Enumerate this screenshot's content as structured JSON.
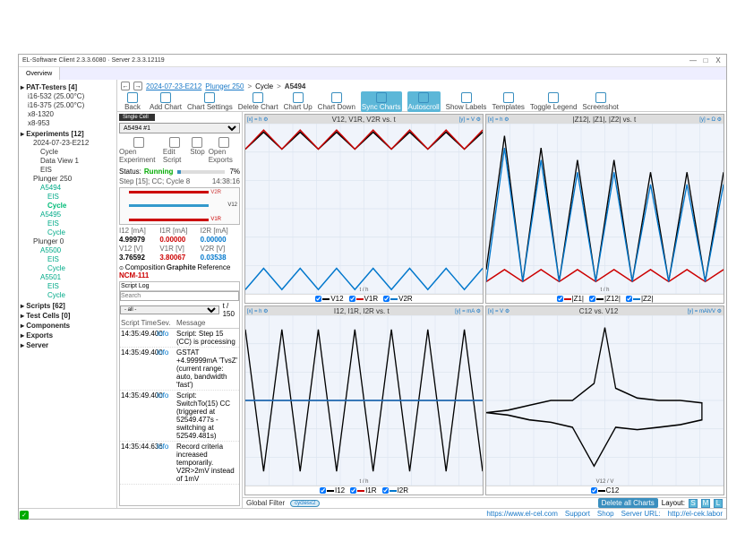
{
  "window": {
    "title": "EL-Software Client 2.3.3.6080 · Server 2.3.3.12119",
    "min": "—",
    "max": "□",
    "close": "X"
  },
  "tabs": {
    "overview": "Overview"
  },
  "sidebar": {
    "groups": [
      {
        "title": "PAT-Testers [4]",
        "items": [
          "i16-532 (25.00°C)",
          "i16-375 (25.00°C)",
          "x8-1320",
          "x8-953"
        ]
      },
      {
        "title": "Experiments [12]",
        "items": [
          {
            "t": "2024-07-23-E212",
            "cls": "ind1"
          },
          {
            "t": "Cycle",
            "cls": "ind2"
          },
          {
            "t": "Data View 1",
            "cls": "ind2"
          },
          {
            "t": "EIS",
            "cls": "ind2"
          },
          {
            "t": "Plunger 250",
            "cls": "ind1"
          },
          {
            "t": "A5494",
            "cls": "ind2 green"
          },
          {
            "t": "EIS",
            "cls": "ind3 green"
          },
          {
            "t": "Cycle",
            "cls": "ind3 sel"
          },
          {
            "t": "A5495",
            "cls": "ind2 green"
          },
          {
            "t": "EIS",
            "cls": "ind3 green"
          },
          {
            "t": "Cycle",
            "cls": "ind3 green"
          },
          {
            "t": "Plunger 0",
            "cls": "ind1"
          },
          {
            "t": "A5500",
            "cls": "ind2 green"
          },
          {
            "t": "EIS",
            "cls": "ind3 green"
          },
          {
            "t": "Cycle",
            "cls": "ind3 green"
          },
          {
            "t": "A5501",
            "cls": "ind2 green"
          },
          {
            "t": "EIS",
            "cls": "ind3 green"
          },
          {
            "t": "Cycle",
            "cls": "ind3 green"
          }
        ]
      },
      {
        "title": "Scripts [62]",
        "items": []
      },
      {
        "title": "Test Cells [0]",
        "items": []
      },
      {
        "title": "Components",
        "items": []
      },
      {
        "title": "Exports",
        "items": []
      },
      {
        "title": "Server",
        "items": []
      }
    ]
  },
  "breadcrumb": {
    "back": "←",
    "fwd": "→",
    "a": "2024-07-23-E212",
    "b": "Plunger 250",
    "c": "Cycle",
    "d": "A5494",
    "sep": ">"
  },
  "toolbar": {
    "items": [
      "Back",
      "Add Chart",
      "Chart Settings",
      "Delete Chart",
      "Chart Up",
      "Chart Down",
      "Sync Charts",
      "Autoscroll",
      "Show Labels",
      "Templates",
      "Toggle Legend",
      "Screenshot"
    ],
    "active": [
      6,
      7
    ]
  },
  "panel": {
    "tab": "Single Cell",
    "selector": "A5494 #1",
    "btns": [
      "Open Experiment",
      "Edit Script",
      "Stop",
      "Open Exports"
    ],
    "status_label": "Status:",
    "status_value": "Running",
    "progress_pct": "7%",
    "step_line_left": "Step [15]; CC; Cycle 8",
    "step_line_right": "14:38:16",
    "cell_labels": {
      "v2r": "V2R",
      "v1r": "V1R",
      "v12": "V12"
    },
    "grid": {
      "h": [
        "I12 [mA]",
        "I1R [mA]",
        "I2R [mA]",
        "V12 [V]",
        "V1R [V]",
        "V2R [V]"
      ],
      "v": [
        "4.99979",
        "0.00000",
        "0.00000",
        "3.76592",
        "3.80067",
        "0.03538"
      ]
    },
    "comp": {
      "label": "Composition",
      "anode": "Graphite",
      "ref": "Reference",
      "cath": "NCM-111"
    },
    "log": {
      "title": "Script Log",
      "search_ph": "Search",
      "filter_all": "- all -",
      "page": "t / 150",
      "cols": [
        "Script Time",
        "Sev.",
        "Message"
      ],
      "rows": [
        [
          "14:35:49.400",
          "Info",
          "Script: Step 15 (CC) is processing"
        ],
        [
          "14:35:49.400",
          "Info",
          "GSTAT +4.99999mA 'TvsZ' (current range: auto, bandwidth 'fast')"
        ],
        [
          "14:35:49.400",
          "Info",
          "Script: SwitchTo(15) CC (triggered at 52549.477s - switching at 52549.481s)"
        ],
        [
          "14:35:44.636",
          "Info",
          "Record criteria increased temporarily. V2R>2mV instead of 1mV"
        ]
      ]
    }
  },
  "charts": [
    {
      "title": "V12, V1R, V2R vs. t",
      "ctrl_l": "[x] = h",
      "ctrl_r": "[y] = V",
      "xlab": "t / h",
      "legend": [
        [
          "V12",
          "#000"
        ],
        [
          "V1R",
          "#c00"
        ],
        [
          "V2R",
          "#07c"
        ]
      ]
    },
    {
      "title": "|Z12|, |Z1|, |Z2| vs. t",
      "ctrl_l": "[x] = h",
      "ctrl_r": "[y] = Ω",
      "xlab": "t / h",
      "legend": [
        [
          "|Z1|",
          "#c00"
        ],
        [
          "|Z12|",
          "#000"
        ],
        [
          "|Z2|",
          "#07c"
        ]
      ]
    },
    {
      "title": "I12, I1R, I2R vs. t",
      "ctrl_l": "[x] = h",
      "ctrl_r": "[y] = mA",
      "xlab": "t / h",
      "legend": [
        [
          "I12",
          "#000"
        ],
        [
          "I1R",
          "#c00"
        ],
        [
          "I2R",
          "#07c"
        ]
      ]
    },
    {
      "title": "C12 vs. V12",
      "ctrl_l": "[x] = V",
      "ctrl_r": "[y] = mAh/V",
      "xlab": "V12 / V",
      "legend": [
        [
          "C12",
          "#000"
        ]
      ]
    }
  ],
  "chart_data": [
    {
      "type": "line",
      "xlim": [
        2,
        15
      ],
      "ylim": [
        0,
        4
      ],
      "x": [
        2,
        3,
        4,
        5,
        6,
        7,
        8,
        9,
        10,
        11,
        12,
        13,
        14,
        15
      ],
      "series": [
        {
          "name": "V12",
          "color": "#000",
          "y": [
            3.4,
            3.8,
            3.4,
            3.8,
            3.4,
            3.8,
            3.4,
            3.8,
            3.4,
            3.8,
            3.4,
            3.8,
            3.4,
            3.8
          ]
        },
        {
          "name": "V1R",
          "color": "#c00",
          "y": [
            3.4,
            3.85,
            3.4,
            3.85,
            3.4,
            3.85,
            3.4,
            3.85,
            3.4,
            3.85,
            3.4,
            3.85,
            3.4,
            3.85
          ]
        },
        {
          "name": "V2R",
          "color": "#07c",
          "y": [
            0.1,
            0.6,
            0.1,
            0.6,
            0.1,
            0.6,
            0.1,
            0.6,
            0.1,
            0.6,
            0.1,
            0.6,
            0.1,
            0.6
          ]
        }
      ]
    },
    {
      "type": "line",
      "xlim": [
        2,
        15
      ],
      "ylim": [
        0,
        14
      ],
      "x": [
        2,
        3,
        4,
        5,
        6,
        7,
        8,
        9,
        10,
        11,
        12,
        13,
        14,
        15
      ],
      "series": [
        {
          "name": "|Z12|",
          "color": "#000",
          "y": [
            2,
            13,
            1,
            12,
            1,
            11,
            1,
            11,
            1,
            10,
            1,
            10,
            1,
            10
          ]
        },
        {
          "name": "|Z1|",
          "color": "#c00",
          "y": [
            1,
            2,
            1,
            2,
            1,
            2,
            1,
            2,
            1,
            2,
            1,
            2,
            1,
            2
          ]
        },
        {
          "name": "|Z2|",
          "color": "#07c",
          "y": [
            1,
            12,
            1,
            11,
            1,
            10,
            1,
            10,
            1,
            9,
            1,
            9,
            1,
            9
          ]
        }
      ]
    },
    {
      "type": "line",
      "xlim": [
        2,
        15
      ],
      "ylim": [
        -6,
        6
      ],
      "x": [
        2,
        3,
        4,
        5,
        6,
        7,
        8,
        9,
        10,
        11,
        12,
        13,
        14,
        15
      ],
      "series": [
        {
          "name": "I12",
          "color": "#000",
          "y": [
            5,
            -5,
            5,
            -5,
            5,
            -5,
            5,
            -5,
            5,
            -5,
            5,
            -5,
            5,
            -5
          ]
        },
        {
          "name": "I1R",
          "color": "#c00",
          "y": [
            0,
            0,
            0,
            0,
            0,
            0,
            0,
            0,
            0,
            0,
            0,
            0,
            0,
            0
          ]
        },
        {
          "name": "I2R",
          "color": "#07c",
          "y": [
            0,
            0,
            0,
            0,
            0,
            0,
            0,
            0,
            0,
            0,
            0,
            0,
            0,
            0
          ]
        }
      ]
    },
    {
      "type": "line",
      "xlim": [
        3.2,
        4.3
      ],
      "ylim": [
        -3,
        4
      ],
      "series": [
        {
          "name": "C12",
          "color": "#000",
          "x": [
            3.2,
            3.3,
            3.4,
            3.5,
            3.6,
            3.7,
            3.75,
            3.8,
            3.9,
            4.0,
            4.1,
            4.2,
            4.2,
            4.1,
            4.0,
            3.9,
            3.8,
            3.7,
            3.6,
            3.5,
            3.4,
            3.3,
            3.2
          ],
          "y": [
            0,
            0.1,
            0.3,
            0.5,
            0.5,
            1.2,
            3.5,
            1.0,
            0.6,
            0.5,
            0.5,
            0.4,
            -0.3,
            -0.5,
            -0.6,
            -0.7,
            -0.6,
            -2.2,
            -0.6,
            -0.4,
            -0.3,
            -0.1,
            0
          ]
        }
      ]
    }
  ],
  "footer": {
    "gf": "Global Filter",
    "pill": "cycles≤2",
    "del": "Delete all Charts",
    "layout": "Layout:",
    "layouts": [
      "S",
      "M",
      "L"
    ]
  },
  "statusbar": {
    "links": [
      "https://www.el-cel.com",
      "Support",
      "Shop"
    ],
    "server_label": "Server URL:",
    "server_url": "http://el-cek.labor"
  }
}
